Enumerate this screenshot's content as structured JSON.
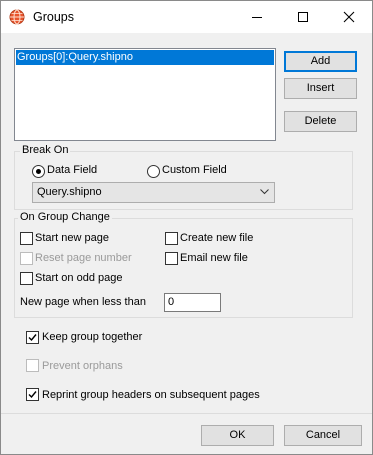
{
  "window": {
    "title": "Groups",
    "icons": [
      "globe-icon",
      "minimize-icon",
      "maximize-icon",
      "close-icon"
    ]
  },
  "groups_list": {
    "items": [
      "Groups[0]:Query.shipno"
    ],
    "selected_index": 0
  },
  "buttons": {
    "add": "Add",
    "insert": "Insert",
    "delete": "Delete",
    "ok": "OK",
    "cancel": "Cancel"
  },
  "break_on": {
    "legend": "Break On",
    "data_field_label": "Data Field",
    "custom_field_label": "Custom Field",
    "selected": "Data Field",
    "field_value": "Query.shipno"
  },
  "on_group_change": {
    "legend": "On Group Change",
    "start_new_page": {
      "label": "Start new page",
      "checked": false,
      "enabled": true
    },
    "reset_page_number": {
      "label": "Reset page number",
      "checked": false,
      "enabled": false
    },
    "start_on_odd_page": {
      "label": "Start on odd page",
      "checked": false,
      "enabled": true
    },
    "create_new_file": {
      "label": "Create new file",
      "checked": false,
      "enabled": true
    },
    "email_new_file": {
      "label": "Email new file",
      "checked": false,
      "enabled": true
    },
    "new_page_when_less_than_label": "New page when less than",
    "new_page_when_less_than_value": "0"
  },
  "options": {
    "keep_group_together": {
      "label": "Keep group together",
      "checked": true,
      "enabled": true
    },
    "prevent_orphans": {
      "label": "Prevent orphans",
      "checked": false,
      "enabled": false
    },
    "reprint_headers": {
      "label": "Reprint group headers on subsequent pages",
      "checked": true,
      "enabled": true
    }
  }
}
